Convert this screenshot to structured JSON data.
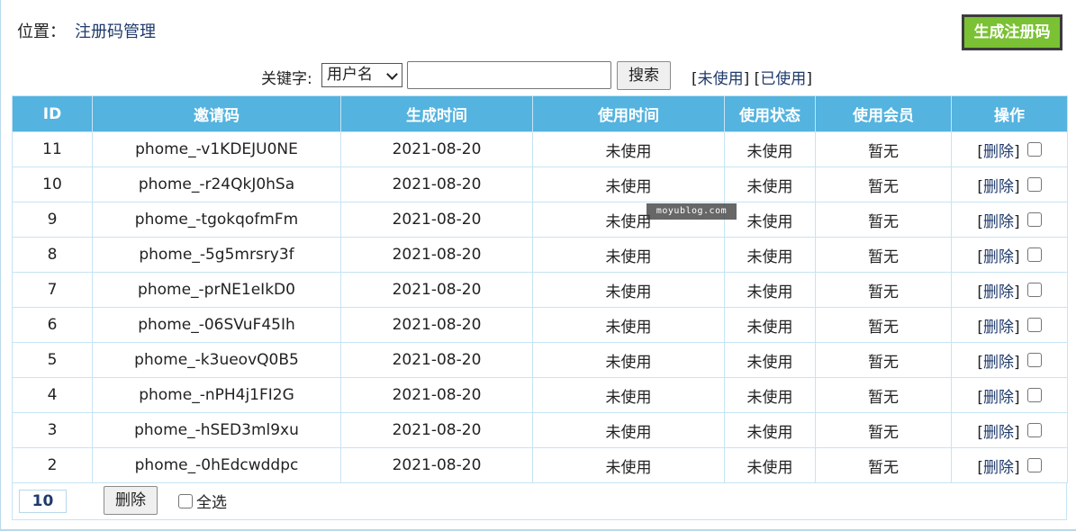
{
  "location": {
    "label": "位置：",
    "crumb": "注册码管理"
  },
  "toolbar": {
    "generate_label": "生成注册码"
  },
  "search": {
    "keyword_label": "关键字:",
    "field_selected": "用户名",
    "input_value": "",
    "button_label": "搜索",
    "filter_unused": "未使用",
    "filter_used": "已使用"
  },
  "watermark": "moyublog.com",
  "table": {
    "headers": [
      "ID",
      "邀请码",
      "生成时间",
      "使用时间",
      "使用状态",
      "使用会员",
      "操作"
    ],
    "delete_label": "删除",
    "rows": [
      {
        "id": "11",
        "code": "phome_-v1KDEJU0NE",
        "created": "2021-08-20",
        "used_time": "未使用",
        "status": "未使用",
        "member": "暂无"
      },
      {
        "id": "10",
        "code": "phome_-r24QkJ0hSa",
        "created": "2021-08-20",
        "used_time": "未使用",
        "status": "未使用",
        "member": "暂无"
      },
      {
        "id": "9",
        "code": "phome_-tgokqofmFm",
        "created": "2021-08-20",
        "used_time": "未使用",
        "status": "未使用",
        "member": "暂无"
      },
      {
        "id": "8",
        "code": "phome_-5g5mrsry3f",
        "created": "2021-08-20",
        "used_time": "未使用",
        "status": "未使用",
        "member": "暂无"
      },
      {
        "id": "7",
        "code": "phome_-prNE1eIkD0",
        "created": "2021-08-20",
        "used_time": "未使用",
        "status": "未使用",
        "member": "暂无"
      },
      {
        "id": "6",
        "code": "phome_-06SVuF45Ih",
        "created": "2021-08-20",
        "used_time": "未使用",
        "status": "未使用",
        "member": "暂无"
      },
      {
        "id": "5",
        "code": "phome_-k3ueovQ0B5",
        "created": "2021-08-20",
        "used_time": "未使用",
        "status": "未使用",
        "member": "暂无"
      },
      {
        "id": "4",
        "code": "phome_-nPH4j1FI2G",
        "created": "2021-08-20",
        "used_time": "未使用",
        "status": "未使用",
        "member": "暂无"
      },
      {
        "id": "3",
        "code": "phome_-hSED3ml9xu",
        "created": "2021-08-20",
        "used_time": "未使用",
        "status": "未使用",
        "member": "暂无"
      },
      {
        "id": "2",
        "code": "phome_-0hEdcwddpc",
        "created": "2021-08-20",
        "used_time": "未使用",
        "status": "未使用",
        "member": "暂无"
      }
    ]
  },
  "footer": {
    "count": "10",
    "delete_button": "删除",
    "select_all_label": "全选"
  }
}
